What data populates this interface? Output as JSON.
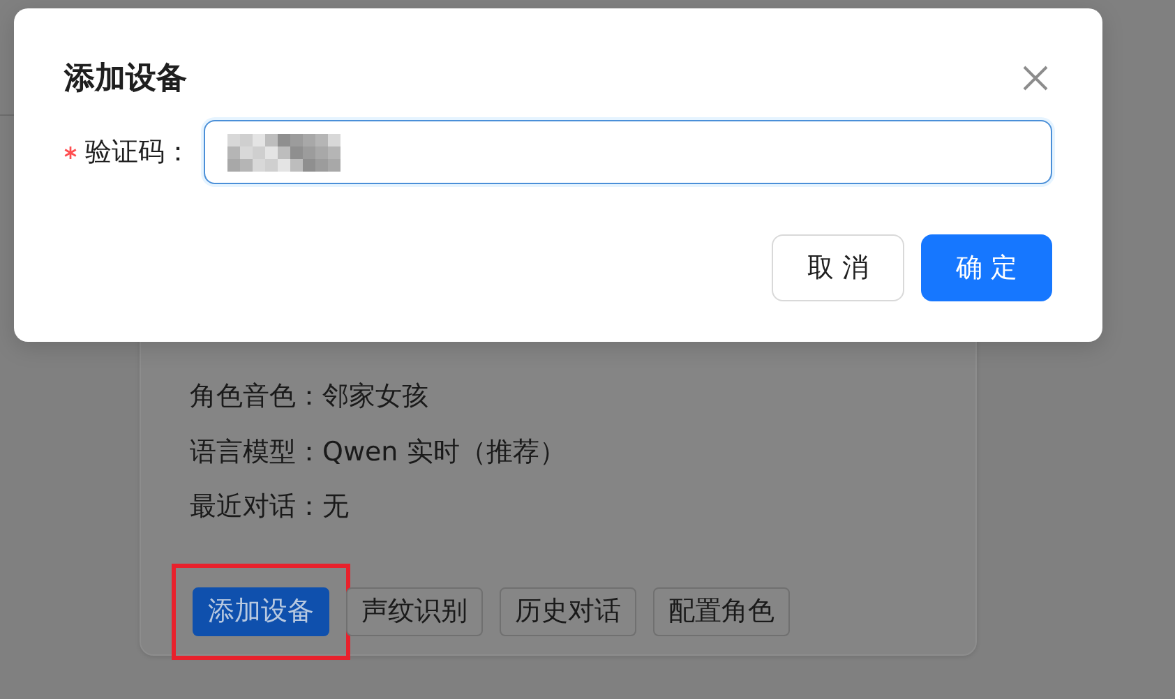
{
  "background_card": {
    "rows": [
      "角色音色：邻家女孩",
      "语言模型：Qwen 实时（推荐）",
      "最近对话：无"
    ],
    "buttons": [
      {
        "label": "添加设备",
        "kind": "primary",
        "highlighted": true
      },
      {
        "label": "声纹识别",
        "kind": "default",
        "highlighted": false
      },
      {
        "label": "历史对话",
        "kind": "default",
        "highlighted": false
      },
      {
        "label": "配置角色",
        "kind": "default",
        "highlighted": false
      }
    ]
  },
  "dialog": {
    "title": "添加设备",
    "fields": [
      {
        "label": "验证码：",
        "required": true,
        "focused": true,
        "redacted": true
      }
    ],
    "buttons": [
      {
        "label": "取 消",
        "kind": "default"
      },
      {
        "label": "确 定",
        "kind": "primary"
      }
    ]
  }
}
